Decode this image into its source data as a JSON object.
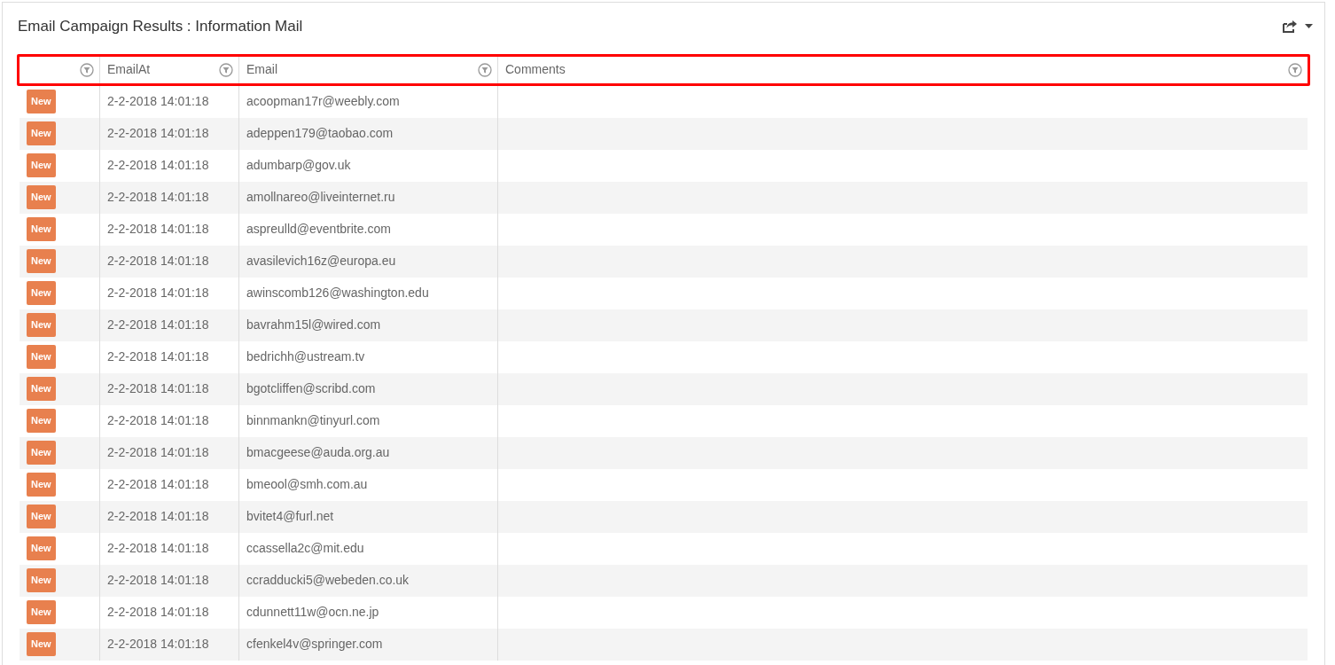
{
  "panel": {
    "title": "Email Campaign Results : Information Mail"
  },
  "table": {
    "columns": [
      {},
      {
        "label": "EmailAt"
      },
      {
        "label": "Email"
      },
      {
        "label": "Comments"
      }
    ],
    "rows": [
      {
        "status": "New",
        "email_at": "2-2-2018 14:01:18",
        "email": "acoopman17r@weebly.com"
      },
      {
        "status": "New",
        "email_at": "2-2-2018 14:01:18",
        "email": "adeppen179@taobao.com"
      },
      {
        "status": "New",
        "email_at": "2-2-2018 14:01:18",
        "email": "adumbarp@gov.uk"
      },
      {
        "status": "New",
        "email_at": "2-2-2018 14:01:18",
        "email": "amollnareo@liveinternet.ru"
      },
      {
        "status": "New",
        "email_at": "2-2-2018 14:01:18",
        "email": "aspreulld@eventbrite.com"
      },
      {
        "status": "New",
        "email_at": "2-2-2018 14:01:18",
        "email": "avasilevich16z@europa.eu"
      },
      {
        "status": "New",
        "email_at": "2-2-2018 14:01:18",
        "email": "awinscomb126@washington.edu"
      },
      {
        "status": "New",
        "email_at": "2-2-2018 14:01:18",
        "email": "bavrahm15l@wired.com"
      },
      {
        "status": "New",
        "email_at": "2-2-2018 14:01:18",
        "email": "bedrichh@ustream.tv"
      },
      {
        "status": "New",
        "email_at": "2-2-2018 14:01:18",
        "email": "bgotcliffen@scribd.com"
      },
      {
        "status": "New",
        "email_at": "2-2-2018 14:01:18",
        "email": "binnmankn@tinyurl.com"
      },
      {
        "status": "New",
        "email_at": "2-2-2018 14:01:18",
        "email": "bmacgeese@auda.org.au"
      },
      {
        "status": "New",
        "email_at": "2-2-2018 14:01:18",
        "email": "bmeool@smh.com.au"
      },
      {
        "status": "New",
        "email_at": "2-2-2018 14:01:18",
        "email": "bvitet4@furl.net"
      },
      {
        "status": "New",
        "email_at": "2-2-2018 14:01:18",
        "email": "ccassella2c@mit.edu"
      },
      {
        "status": "New",
        "email_at": "2-2-2018 14:01:18",
        "email": "ccradducki5@webeden.co.uk"
      },
      {
        "status": "New",
        "email_at": "2-2-2018 14:01:18",
        "email": "cdunnett11w@ocn.ne.jp"
      },
      {
        "status": "New",
        "email_at": "2-2-2018 14:01:18",
        "email": "cfenkel4v@springer.com"
      }
    ]
  }
}
